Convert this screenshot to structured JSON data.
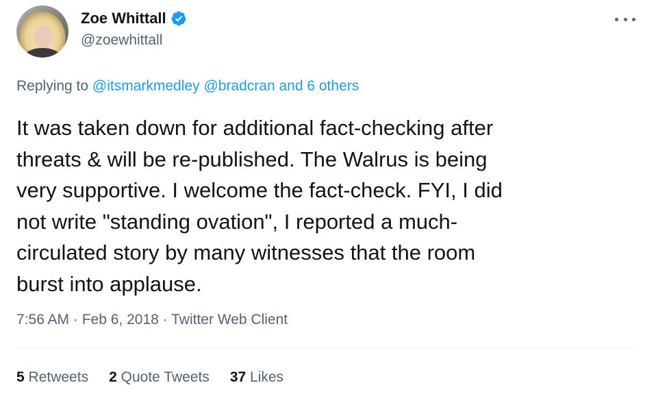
{
  "author": {
    "name": "Zoe Whittall",
    "handle": "@zoewhittall",
    "verified": true
  },
  "icons": {
    "avatar": "profile-photo",
    "verified": "verified-badge-icon",
    "more": "more-options-icon"
  },
  "reply": {
    "prefix": "Replying to ",
    "mention1": "@itsmarkmedley",
    "mention2": "@bradcran",
    "and_others": "and 6 others"
  },
  "tweet": {
    "lines": [
      "It was taken down for additional fact-checking after",
      "threats & will be re-published. The Walrus is being",
      "very supportive. I welcome the fact-check. FYI, I did",
      "not write \"standing ovation\", I reported a much-",
      "circulated story by many witnesses that the room",
      "burst into applause."
    ]
  },
  "meta": {
    "time": "7:56 AM",
    "date": "Feb 6, 2018",
    "client": "Twitter Web Client"
  },
  "stats": {
    "retweets_count": "5",
    "retweets_label": "Retweets",
    "quotes_count": "2",
    "quotes_label": "Quote Tweets",
    "likes_count": "37",
    "likes_label": "Likes"
  },
  "colors": {
    "text": "#0f1419",
    "secondary": "#536471",
    "accent": "#1d9bf0",
    "divider": "#eff3f4"
  }
}
